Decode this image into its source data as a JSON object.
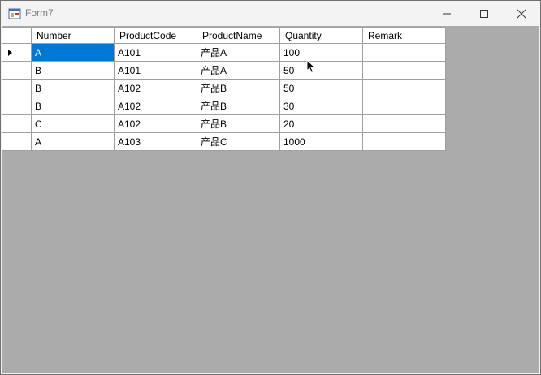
{
  "window": {
    "title": "Form7",
    "controls": {
      "minimize": "minimize-icon",
      "maximize": "maximize-icon",
      "close": "close-icon"
    }
  },
  "grid": {
    "columns": [
      "Number",
      "ProductCode",
      "ProductName",
      "Quantity",
      "Remark"
    ],
    "rows": [
      {
        "number": "A",
        "product_code": "A101",
        "product_name": "产品A",
        "quantity": "100",
        "remark": ""
      },
      {
        "number": "B",
        "product_code": "A101",
        "product_name": "产品A",
        "quantity": "50",
        "remark": ""
      },
      {
        "number": "B",
        "product_code": "A102",
        "product_name": "产品B",
        "quantity": "50",
        "remark": ""
      },
      {
        "number": "B",
        "product_code": "A102",
        "product_name": "产品B",
        "quantity": "30",
        "remark": ""
      },
      {
        "number": "C",
        "product_code": "A102",
        "product_name": "产品B",
        "quantity": "20",
        "remark": ""
      },
      {
        "number": "A",
        "product_code": "A103",
        "product_name": "产品C",
        "quantity": "1000",
        "remark": ""
      }
    ],
    "current_row": 0,
    "selection_color": "#0078d7"
  }
}
